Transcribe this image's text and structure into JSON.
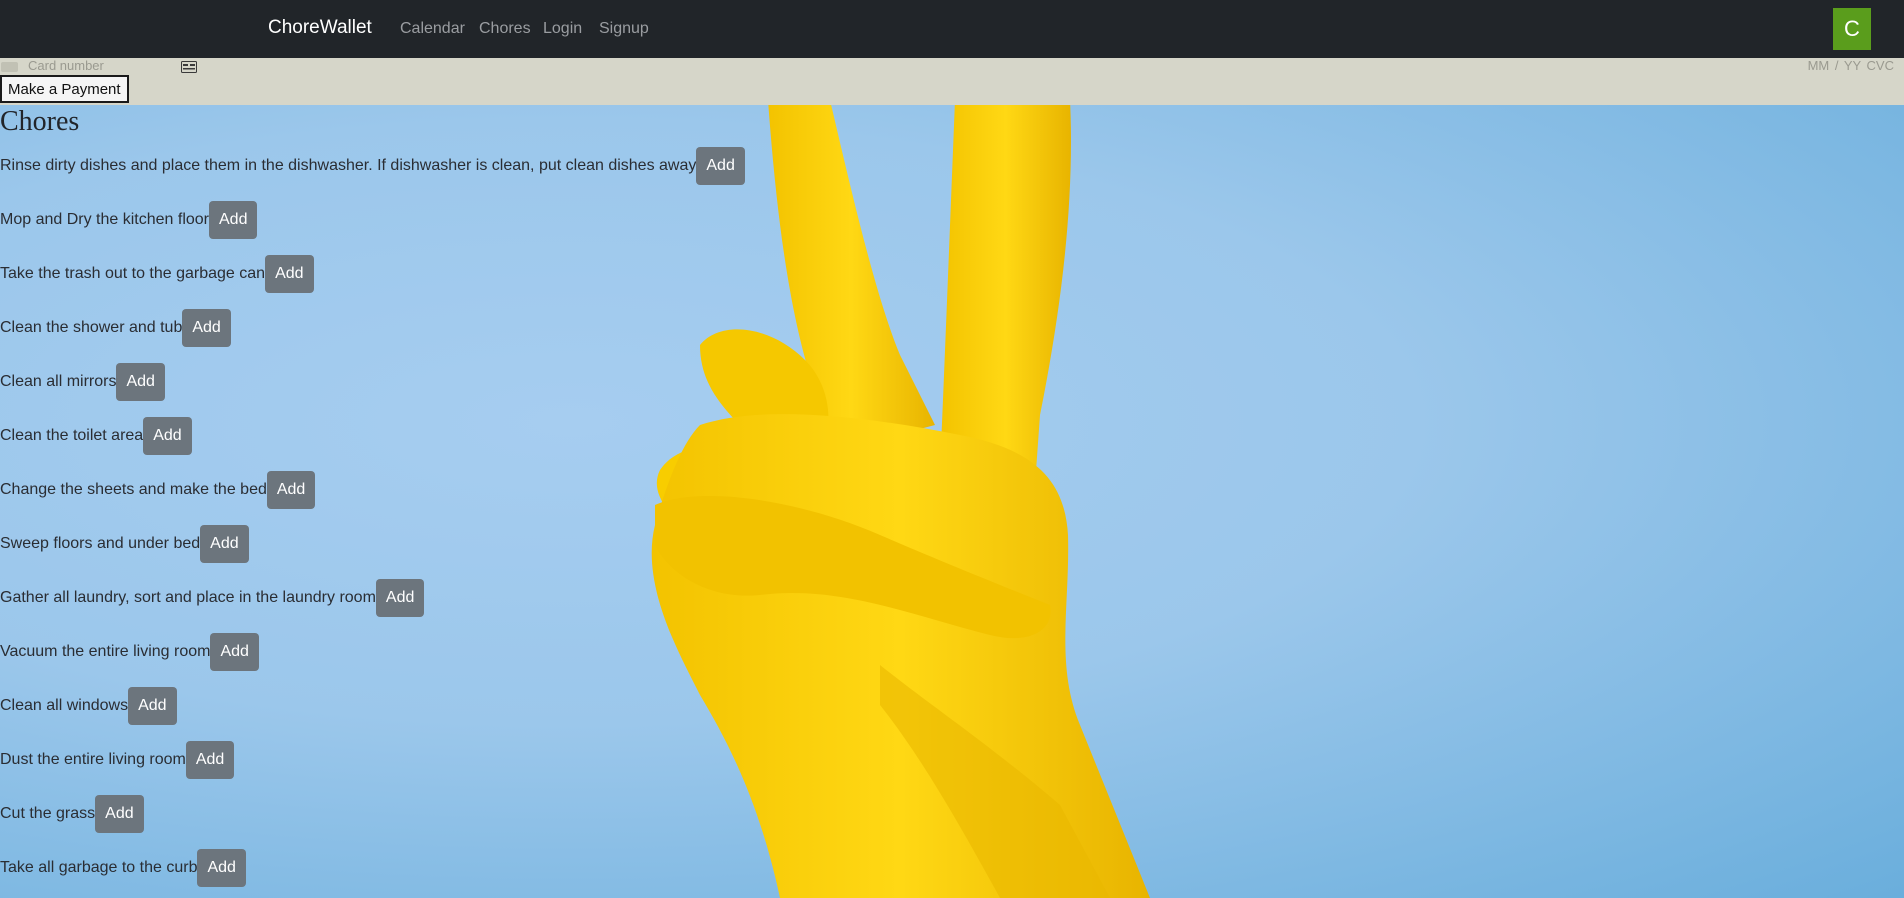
{
  "navbar": {
    "brand": "ChoreWallet",
    "links": [
      "Calendar",
      "Chores",
      "Login",
      "Signup"
    ],
    "avatar_letter": "C",
    "avatar_color": "#5a9d1c"
  },
  "payment": {
    "card_number_placeholder": "Card number",
    "expiry_cvc_placeholder": "MM / YY  CVC",
    "button_label": "Make a Payment"
  },
  "chores": {
    "title": "Chores",
    "add_label": "Add",
    "items": [
      "Rinse dirty dishes and place them in the dishwasher. If dishwasher is clean, put clean dishes away",
      "Mop and Dry the kitchen floor",
      "Take the trash out to the garbage can",
      "Clean the shower and tub",
      "Clean all mirrors",
      "Clean the toilet area",
      "Change the sheets and make the bed",
      "Sweep floors and under bed",
      "Gather all laundry, sort and place in the laundry room",
      "Vacuum the entire living room",
      "Clean all windows",
      "Dust the entire living room",
      "Cut the grass",
      "Take all garbage to the curb"
    ]
  },
  "colors": {
    "navbar_bg": "#212529",
    "pay_strip_bg": "#d6d6c9",
    "background_blue": "#9bc7eb",
    "glove_yellow": "#f7d10a",
    "add_button": "#6c757d"
  }
}
